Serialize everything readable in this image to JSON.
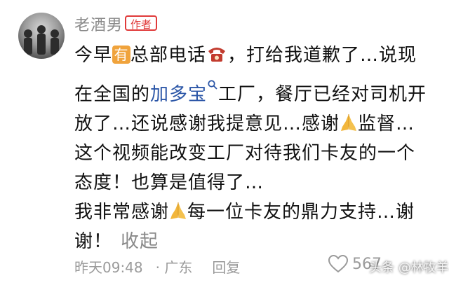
{
  "comment": {
    "username": "老酒男",
    "author_badge": "作者",
    "text_1": "今早",
    "you_badge": "有",
    "text_2": "总部电话",
    "text_3": "，打给我道歉了…说现在全国的",
    "link_text": "加多宝",
    "text_4": "工厂，餐厅已经对司机开放了…还说感谢我提意见…感谢",
    "text_5": "监督…",
    "line_2": "这个视频能改变工厂对待我们卡友的一个态度！也算是值得了…",
    "text_6": "我非常感谢",
    "text_7": "每一位卡友的鼎力支持…谢谢！",
    "collapse_label": "收起",
    "time": "昨天09:48",
    "location": "· 广东",
    "reply_label": "回复",
    "like_count": "567"
  },
  "watermark": {
    "text": "头条 @林牧羊"
  },
  "colors": {
    "link": "#2b56a7",
    "badge_red": "#e03a3a",
    "you_orange": "#f0a33c",
    "meta_gray": "#9a9a9a"
  },
  "icons": [
    "avatar-image",
    "phone-icon",
    "search-icon",
    "pray-icon",
    "heart-icon"
  ]
}
